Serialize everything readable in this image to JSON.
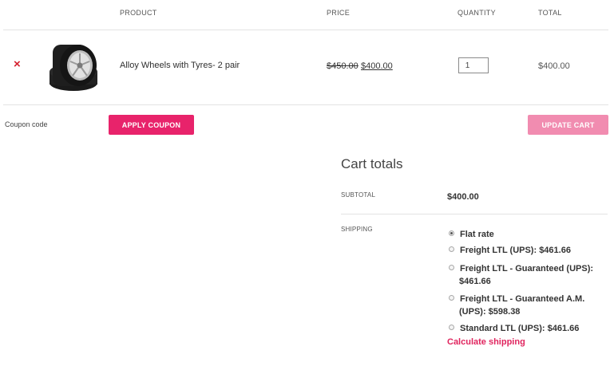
{
  "table": {
    "headers": {
      "product": "PRODUCT",
      "price": "PRICE",
      "quantity": "QUANTITY",
      "total": "TOTAL"
    }
  },
  "cart_item": {
    "remove_symbol": "×",
    "image_icon": "tire-wheel-image",
    "name": "Alloy Wheels with Tyres- 2 pair",
    "price_old": "$450.00",
    "price_new": "$400.00",
    "quantity": "1",
    "total": "$400.00"
  },
  "coupon": {
    "placeholder": "Coupon code",
    "apply_label": "APPLY COUPON"
  },
  "update_cart_label": "UPDATE CART",
  "cart_totals": {
    "title": "Cart totals",
    "subtotal_label": "SUBTOTAL",
    "subtotal_value": "$400.00",
    "shipping_label": "SHIPPING",
    "shipping_options": [
      {
        "line1": "Flat rate",
        "line2": "",
        "selected": true
      },
      {
        "line1": "Freight LTL (UPS): $461.66",
        "line2": "",
        "selected": false
      },
      {
        "line1": "Freight LTL - Guaranteed (UPS):",
        "line2": "$461.66",
        "selected": false
      },
      {
        "line1": "Freight LTL - Guaranteed A.M.",
        "line2": "(UPS): $598.38",
        "selected": false
      },
      {
        "line1": "Standard LTL (UPS): $461.66",
        "line2": "",
        "selected": false
      }
    ],
    "calculate_shipping": "Calculate shipping"
  },
  "colors": {
    "accent": "#e8236b",
    "accent_light": "#f18cb0",
    "remove": "#d5202f",
    "link": "#e0245e"
  }
}
